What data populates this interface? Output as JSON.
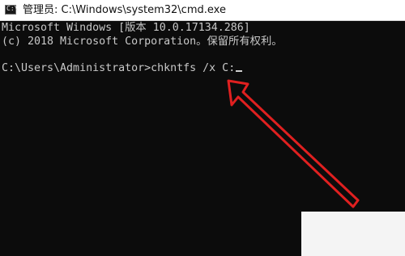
{
  "window": {
    "title": "管理员: C:\\Windows\\system32\\cmd.exe",
    "icon_prompt": "C:\\"
  },
  "console": {
    "line1": "Microsoft Windows [版本 10.0.17134.286]",
    "line2": "(c) 2018 Microsoft Corporation。保留所有权利。",
    "prompt": "C:\\Users\\Administrator>",
    "command": "chkntfs /x C:"
  },
  "colors": {
    "console_bg": "#0c0c0c",
    "console_text": "#c8c8c8",
    "titlebar_bg": "#ffffff",
    "annotation_arrow": "#e02020"
  },
  "icons": {
    "app": "cmd-icon",
    "annotation": "red-arrow-annotation"
  }
}
